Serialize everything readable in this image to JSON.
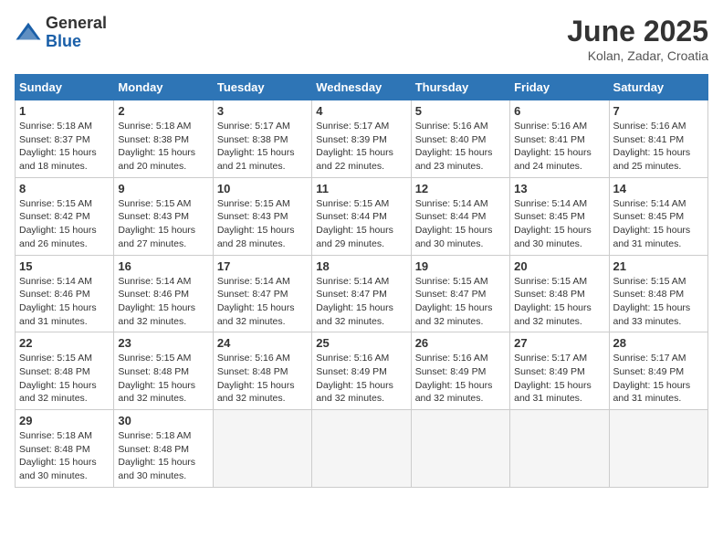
{
  "header": {
    "logo": {
      "general": "General",
      "blue": "Blue"
    },
    "title": "June 2025",
    "subtitle": "Kolan, Zadar, Croatia"
  },
  "calendar": {
    "weekdays": [
      "Sunday",
      "Monday",
      "Tuesday",
      "Wednesday",
      "Thursday",
      "Friday",
      "Saturday"
    ],
    "weeks": [
      [
        {
          "day": "1",
          "sunrise": "Sunrise: 5:18 AM",
          "sunset": "Sunset: 8:37 PM",
          "daylight": "Daylight: 15 hours and 18 minutes."
        },
        {
          "day": "2",
          "sunrise": "Sunrise: 5:18 AM",
          "sunset": "Sunset: 8:38 PM",
          "daylight": "Daylight: 15 hours and 20 minutes."
        },
        {
          "day": "3",
          "sunrise": "Sunrise: 5:17 AM",
          "sunset": "Sunset: 8:38 PM",
          "daylight": "Daylight: 15 hours and 21 minutes."
        },
        {
          "day": "4",
          "sunrise": "Sunrise: 5:17 AM",
          "sunset": "Sunset: 8:39 PM",
          "daylight": "Daylight: 15 hours and 22 minutes."
        },
        {
          "day": "5",
          "sunrise": "Sunrise: 5:16 AM",
          "sunset": "Sunset: 8:40 PM",
          "daylight": "Daylight: 15 hours and 23 minutes."
        },
        {
          "day": "6",
          "sunrise": "Sunrise: 5:16 AM",
          "sunset": "Sunset: 8:41 PM",
          "daylight": "Daylight: 15 hours and 24 minutes."
        },
        {
          "day": "7",
          "sunrise": "Sunrise: 5:16 AM",
          "sunset": "Sunset: 8:41 PM",
          "daylight": "Daylight: 15 hours and 25 minutes."
        }
      ],
      [
        {
          "day": "8",
          "sunrise": "Sunrise: 5:15 AM",
          "sunset": "Sunset: 8:42 PM",
          "daylight": "Daylight: 15 hours and 26 minutes."
        },
        {
          "day": "9",
          "sunrise": "Sunrise: 5:15 AM",
          "sunset": "Sunset: 8:43 PM",
          "daylight": "Daylight: 15 hours and 27 minutes."
        },
        {
          "day": "10",
          "sunrise": "Sunrise: 5:15 AM",
          "sunset": "Sunset: 8:43 PM",
          "daylight": "Daylight: 15 hours and 28 minutes."
        },
        {
          "day": "11",
          "sunrise": "Sunrise: 5:15 AM",
          "sunset": "Sunset: 8:44 PM",
          "daylight": "Daylight: 15 hours and 29 minutes."
        },
        {
          "day": "12",
          "sunrise": "Sunrise: 5:14 AM",
          "sunset": "Sunset: 8:44 PM",
          "daylight": "Daylight: 15 hours and 30 minutes."
        },
        {
          "day": "13",
          "sunrise": "Sunrise: 5:14 AM",
          "sunset": "Sunset: 8:45 PM",
          "daylight": "Daylight: 15 hours and 30 minutes."
        },
        {
          "day": "14",
          "sunrise": "Sunrise: 5:14 AM",
          "sunset": "Sunset: 8:45 PM",
          "daylight": "Daylight: 15 hours and 31 minutes."
        }
      ],
      [
        {
          "day": "15",
          "sunrise": "Sunrise: 5:14 AM",
          "sunset": "Sunset: 8:46 PM",
          "daylight": "Daylight: 15 hours and 31 minutes."
        },
        {
          "day": "16",
          "sunrise": "Sunrise: 5:14 AM",
          "sunset": "Sunset: 8:46 PM",
          "daylight": "Daylight: 15 hours and 32 minutes."
        },
        {
          "day": "17",
          "sunrise": "Sunrise: 5:14 AM",
          "sunset": "Sunset: 8:47 PM",
          "daylight": "Daylight: 15 hours and 32 minutes."
        },
        {
          "day": "18",
          "sunrise": "Sunrise: 5:14 AM",
          "sunset": "Sunset: 8:47 PM",
          "daylight": "Daylight: 15 hours and 32 minutes."
        },
        {
          "day": "19",
          "sunrise": "Sunrise: 5:15 AM",
          "sunset": "Sunset: 8:47 PM",
          "daylight": "Daylight: 15 hours and 32 minutes."
        },
        {
          "day": "20",
          "sunrise": "Sunrise: 5:15 AM",
          "sunset": "Sunset: 8:48 PM",
          "daylight": "Daylight: 15 hours and 32 minutes."
        },
        {
          "day": "21",
          "sunrise": "Sunrise: 5:15 AM",
          "sunset": "Sunset: 8:48 PM",
          "daylight": "Daylight: 15 hours and 33 minutes."
        }
      ],
      [
        {
          "day": "22",
          "sunrise": "Sunrise: 5:15 AM",
          "sunset": "Sunset: 8:48 PM",
          "daylight": "Daylight: 15 hours and 32 minutes."
        },
        {
          "day": "23",
          "sunrise": "Sunrise: 5:15 AM",
          "sunset": "Sunset: 8:48 PM",
          "daylight": "Daylight: 15 hours and 32 minutes."
        },
        {
          "day": "24",
          "sunrise": "Sunrise: 5:16 AM",
          "sunset": "Sunset: 8:48 PM",
          "daylight": "Daylight: 15 hours and 32 minutes."
        },
        {
          "day": "25",
          "sunrise": "Sunrise: 5:16 AM",
          "sunset": "Sunset: 8:49 PM",
          "daylight": "Daylight: 15 hours and 32 minutes."
        },
        {
          "day": "26",
          "sunrise": "Sunrise: 5:16 AM",
          "sunset": "Sunset: 8:49 PM",
          "daylight": "Daylight: 15 hours and 32 minutes."
        },
        {
          "day": "27",
          "sunrise": "Sunrise: 5:17 AM",
          "sunset": "Sunset: 8:49 PM",
          "daylight": "Daylight: 15 hours and 31 minutes."
        },
        {
          "day": "28",
          "sunrise": "Sunrise: 5:17 AM",
          "sunset": "Sunset: 8:49 PM",
          "daylight": "Daylight: 15 hours and 31 minutes."
        }
      ],
      [
        {
          "day": "29",
          "sunrise": "Sunrise: 5:18 AM",
          "sunset": "Sunset: 8:48 PM",
          "daylight": "Daylight: 15 hours and 30 minutes."
        },
        {
          "day": "30",
          "sunrise": "Sunrise: 5:18 AM",
          "sunset": "Sunset: 8:48 PM",
          "daylight": "Daylight: 15 hours and 30 minutes."
        },
        null,
        null,
        null,
        null,
        null
      ]
    ]
  }
}
